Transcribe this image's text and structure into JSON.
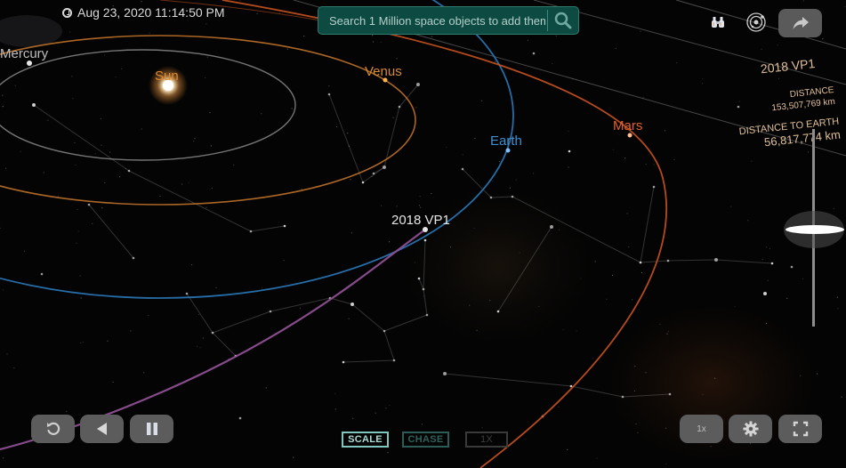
{
  "header": {
    "datetime": "Aug 23, 2020 11:14:50 PM",
    "search_placeholder": "Search 1 Million space objects to add them"
  },
  "toolbar_icons": [
    "binoculars-icon",
    "orbit-icon",
    "share-icon"
  ],
  "scene": {
    "labels": {
      "mercury": "Mercury",
      "sun": "Sun",
      "venus": "Venus",
      "earth": "Earth",
      "mars": "Mars",
      "target": "2018 VP1"
    },
    "colors": {
      "mercury_orbit": "#9a9a9a",
      "venus_orbit": "#c9782c",
      "earth_orbit": "#2a78b8",
      "mars_orbit": "#c9521f",
      "target_orbit": "#8e4f93",
      "sun_label": "#e08a2a",
      "venus_label": "#d58a3a",
      "earth_label": "#3f8fd0",
      "mars_label": "#e0602f",
      "target_label": "#e6e6e6",
      "mercury_label": "#bdbdbd"
    }
  },
  "info_panel": {
    "object_name": "2018 VP1",
    "distance_label": "DISTANCE",
    "distance_value": "153,507,769 km",
    "earth_distance_label": "DISTANCE TO EARTH",
    "earth_distance_value": "56,817,774 km"
  },
  "zoom_slider": {
    "level_fraction": 0.5
  },
  "bottom_left": {
    "buttons": [
      "reset-icon",
      "reverse-icon",
      "pause-icon"
    ]
  },
  "modes": {
    "scale": "SCALE",
    "chase": "CHASE",
    "speed": "1X"
  },
  "bottom_right": {
    "speed_label": "1x",
    "buttons": [
      "gear-icon",
      "fullscreen-icon"
    ]
  }
}
